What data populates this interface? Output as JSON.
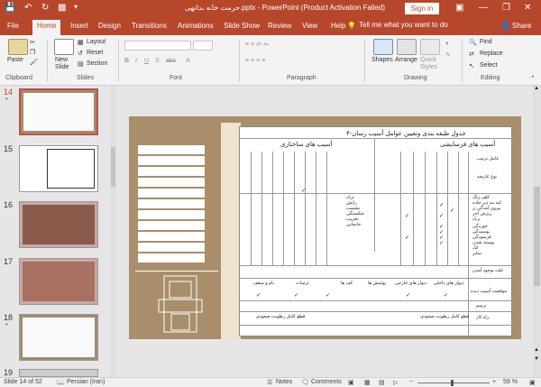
{
  "window": {
    "title": "حرمت خانه بدانهی.pptx - PowerPoint (Product Activation Failed)",
    "signin": "Sign in",
    "restore_icon": "restore-icon"
  },
  "tabs": [
    "File",
    "Home",
    "Insert",
    "Design",
    "Transitions",
    "Animations",
    "Slide Show",
    "Review",
    "View",
    "Help"
  ],
  "tell_me": "Tell me what you want to do",
  "share": "Share",
  "ribbon": {
    "paste": "Paste",
    "new_slide": "New\nSlide",
    "layout": "Layout",
    "reset": "Reset",
    "section": "Section",
    "shapes": "Shapes",
    "arrange": "Arrange",
    "quick_styles": "Quick\nStyles",
    "find": "Find",
    "replace": "Replace",
    "select": "Select",
    "groups": [
      "Clipboard",
      "Slides",
      "Font",
      "Paragraph",
      "Drawing",
      "Editing"
    ]
  },
  "slides": [
    {
      "num": "14",
      "star": "*"
    },
    {
      "num": "15",
      "star": ""
    },
    {
      "num": "16",
      "star": ""
    },
    {
      "num": "17",
      "star": ""
    },
    {
      "num": "18",
      "star": "*"
    },
    {
      "num": "19",
      "star": ""
    }
  ],
  "slide_content": {
    "heading": "۴-جدول طبقه بندی وتعیین عوامل آسیب رسان",
    "col_natural": "آسیب های فرسایشی",
    "col_structural": "آسیب های ساختاری",
    "row_labels": [
      "عامل ترتیب",
      "نوع عارضه",
      "کلف زنگ",
      "کبه بند دبر جاده",
      "بیرون آمدگی ن",
      "ریزش آجر",
      "ترک",
      "خوردگی",
      "پوسیدگی",
      "فرسودگی",
      "پوسته شدن",
      "لک",
      "سایر"
    ],
    "structural_labels": [
      "ترک",
      "رانش",
      "نشست",
      "شکستگی",
      "تخریب",
      "جابجایی"
    ],
    "bottom_labels": [
      "علت بوجود آمدن",
      "موقعیت آسیب دیده",
      "ترمیم",
      "راه کار"
    ],
    "loc_labels": [
      "دیوار های داخلی",
      "دیوار های خارجی",
      "پوشش ها",
      "کف ها",
      "تزئینات",
      "بام و سقف"
    ],
    "recommend": "قطع کامل رطوبت صعودی"
  },
  "status": {
    "slide": "Slide 14 of 52",
    "lang": "Persian (Iran)",
    "notes": "Notes",
    "comments": "Comments",
    "zoom": "59 %"
  }
}
